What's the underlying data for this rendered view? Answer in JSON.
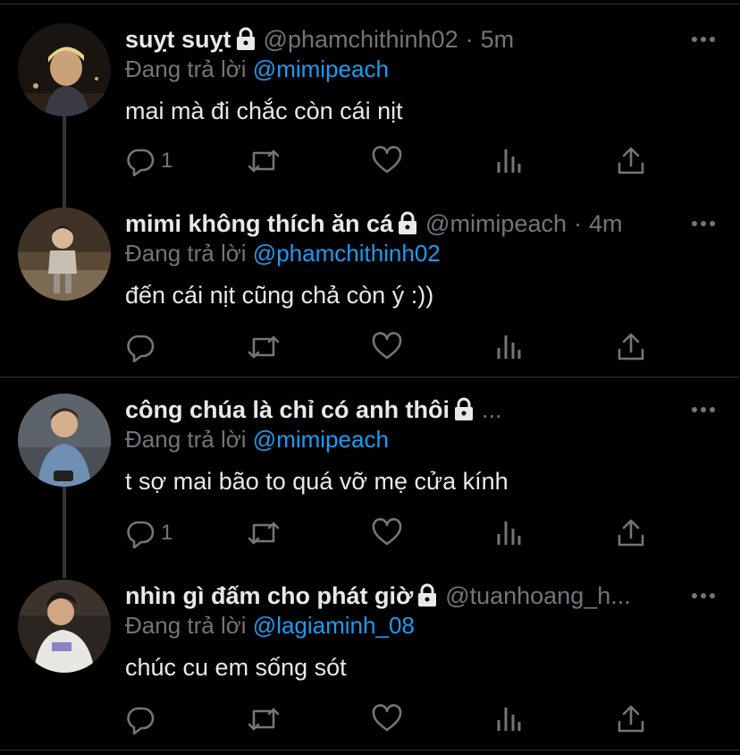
{
  "colors": {
    "background": "#000000",
    "text": "#e7e9ea",
    "muted": "#71767b",
    "mention": "#1d9bf0",
    "divider": "#2f3336"
  },
  "reply_prefix": "Đang trả lời",
  "tweets": [
    {
      "display_name": "suỵt suỵt",
      "locked": true,
      "handle": "@phamchithinh02",
      "separator": "·",
      "time": "5m",
      "reply_to": "@mimipeach",
      "text": "mai mà đi chắc còn cái nịt",
      "reply_count": "1",
      "icons": [
        "reply-icon",
        "retweet-icon",
        "like-icon",
        "analytics-icon",
        "share-icon"
      ]
    },
    {
      "display_name": "mimi không thích ăn cá",
      "locked": true,
      "handle": "@mimipeach",
      "separator": "·",
      "time": "4m",
      "reply_to": "@phamchithinh02",
      "text": "đến cái nịt cũng chả còn ý :))",
      "reply_count": "",
      "icons": [
        "reply-icon",
        "retweet-icon",
        "like-icon",
        "analytics-icon",
        "share-icon"
      ]
    },
    {
      "display_name": "công chúa là chỉ có anh thôi",
      "locked": true,
      "handle": "...",
      "separator": "",
      "time": "",
      "reply_to": "@mimipeach",
      "text": "t sợ mai bão to quá vỡ mẹ cửa kính",
      "reply_count": "1",
      "icons": [
        "reply-icon",
        "retweet-icon",
        "like-icon",
        "analytics-icon",
        "share-icon"
      ]
    },
    {
      "display_name": "nhìn gì đấm cho phát giờ",
      "locked": true,
      "handle": "@tuanhoang_h...",
      "separator": "",
      "time": "",
      "reply_to": "@lagiaminh_08",
      "text": "chúc cu em sống sót",
      "reply_count": "",
      "icons": [
        "reply-icon",
        "retweet-icon",
        "like-icon",
        "analytics-icon",
        "share-icon"
      ]
    }
  ]
}
